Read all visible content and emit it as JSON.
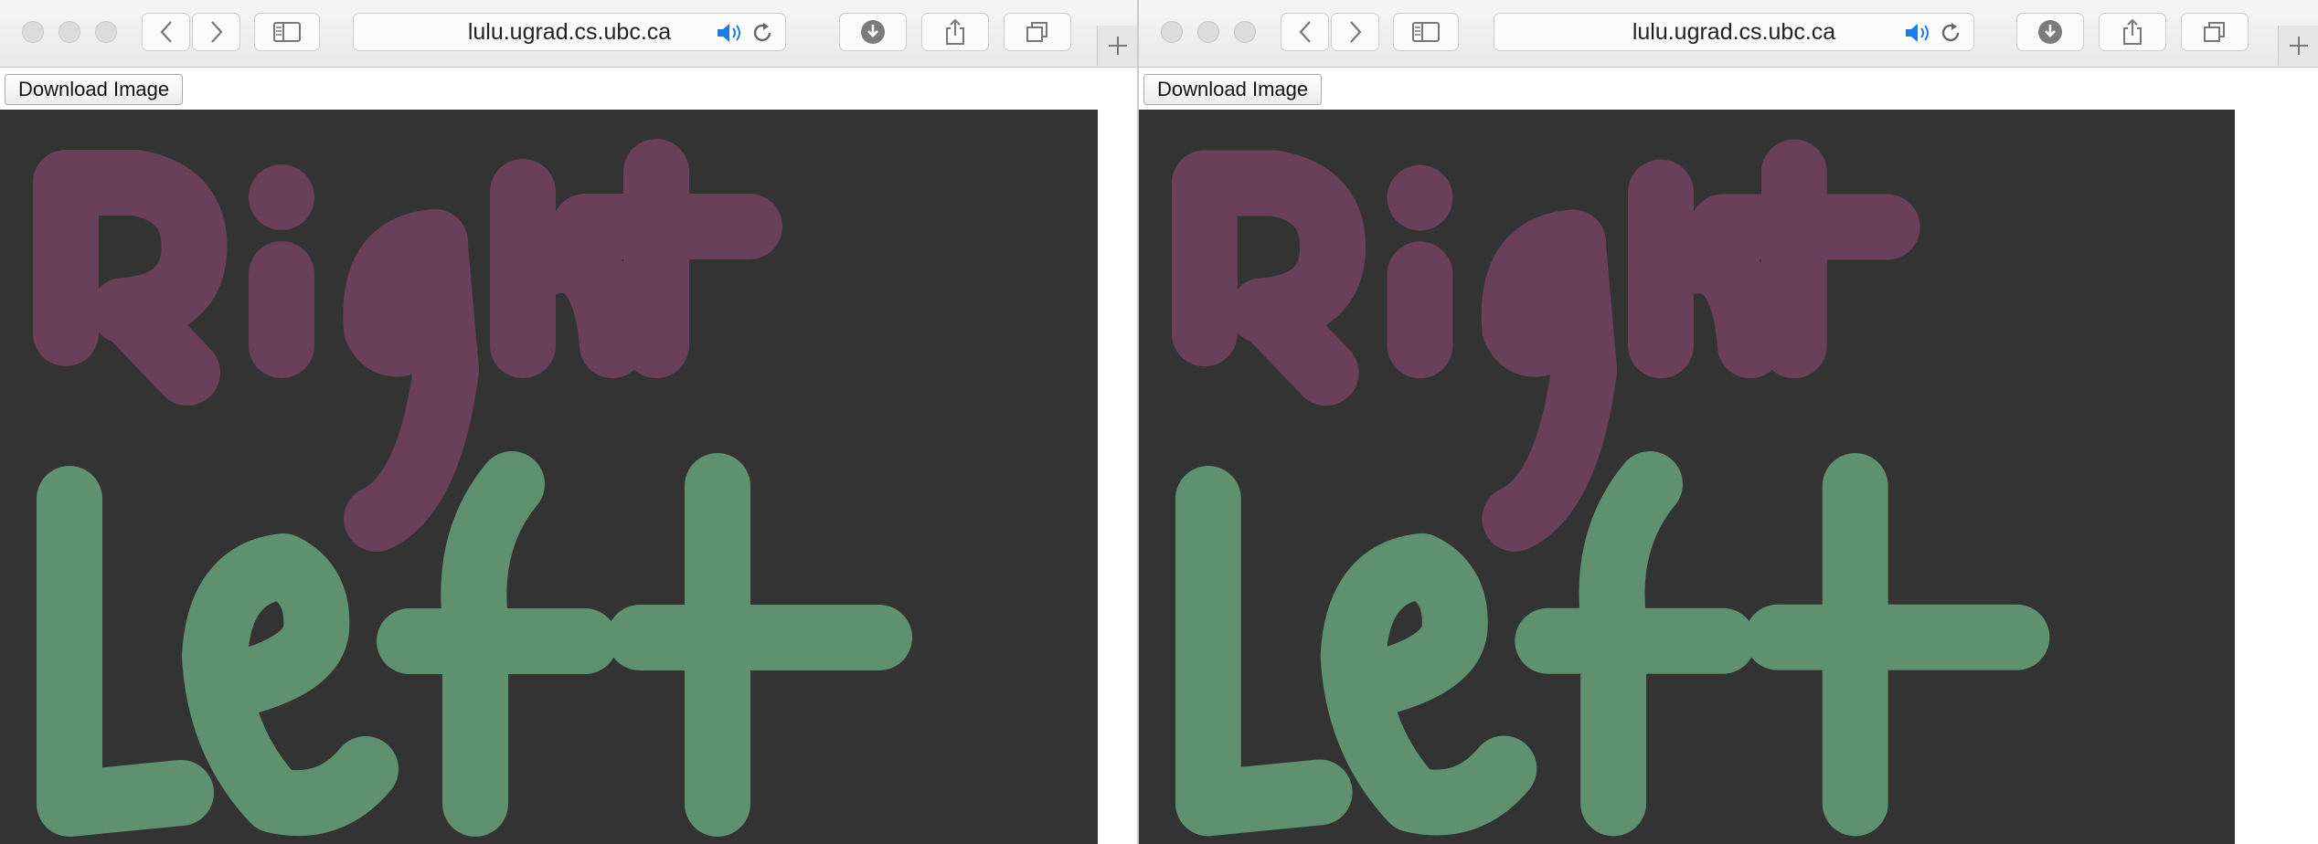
{
  "browser": {
    "url": "lulu.ugrad.cs.ubc.ca",
    "icons": [
      "back-chevron-icon",
      "forward-chevron-icon",
      "sidebar-icon",
      "speaker-icon",
      "reload-icon",
      "download-icon",
      "share-icon",
      "tabs-icon",
      "plus-icon"
    ]
  },
  "page": {
    "download_label": "Download Image"
  },
  "drawing": {
    "canvas_color": "#333333",
    "words": [
      {
        "text": "Right",
        "color": "#6a3f5a"
      },
      {
        "text": "Left",
        "color": "#5f9171"
      }
    ]
  }
}
